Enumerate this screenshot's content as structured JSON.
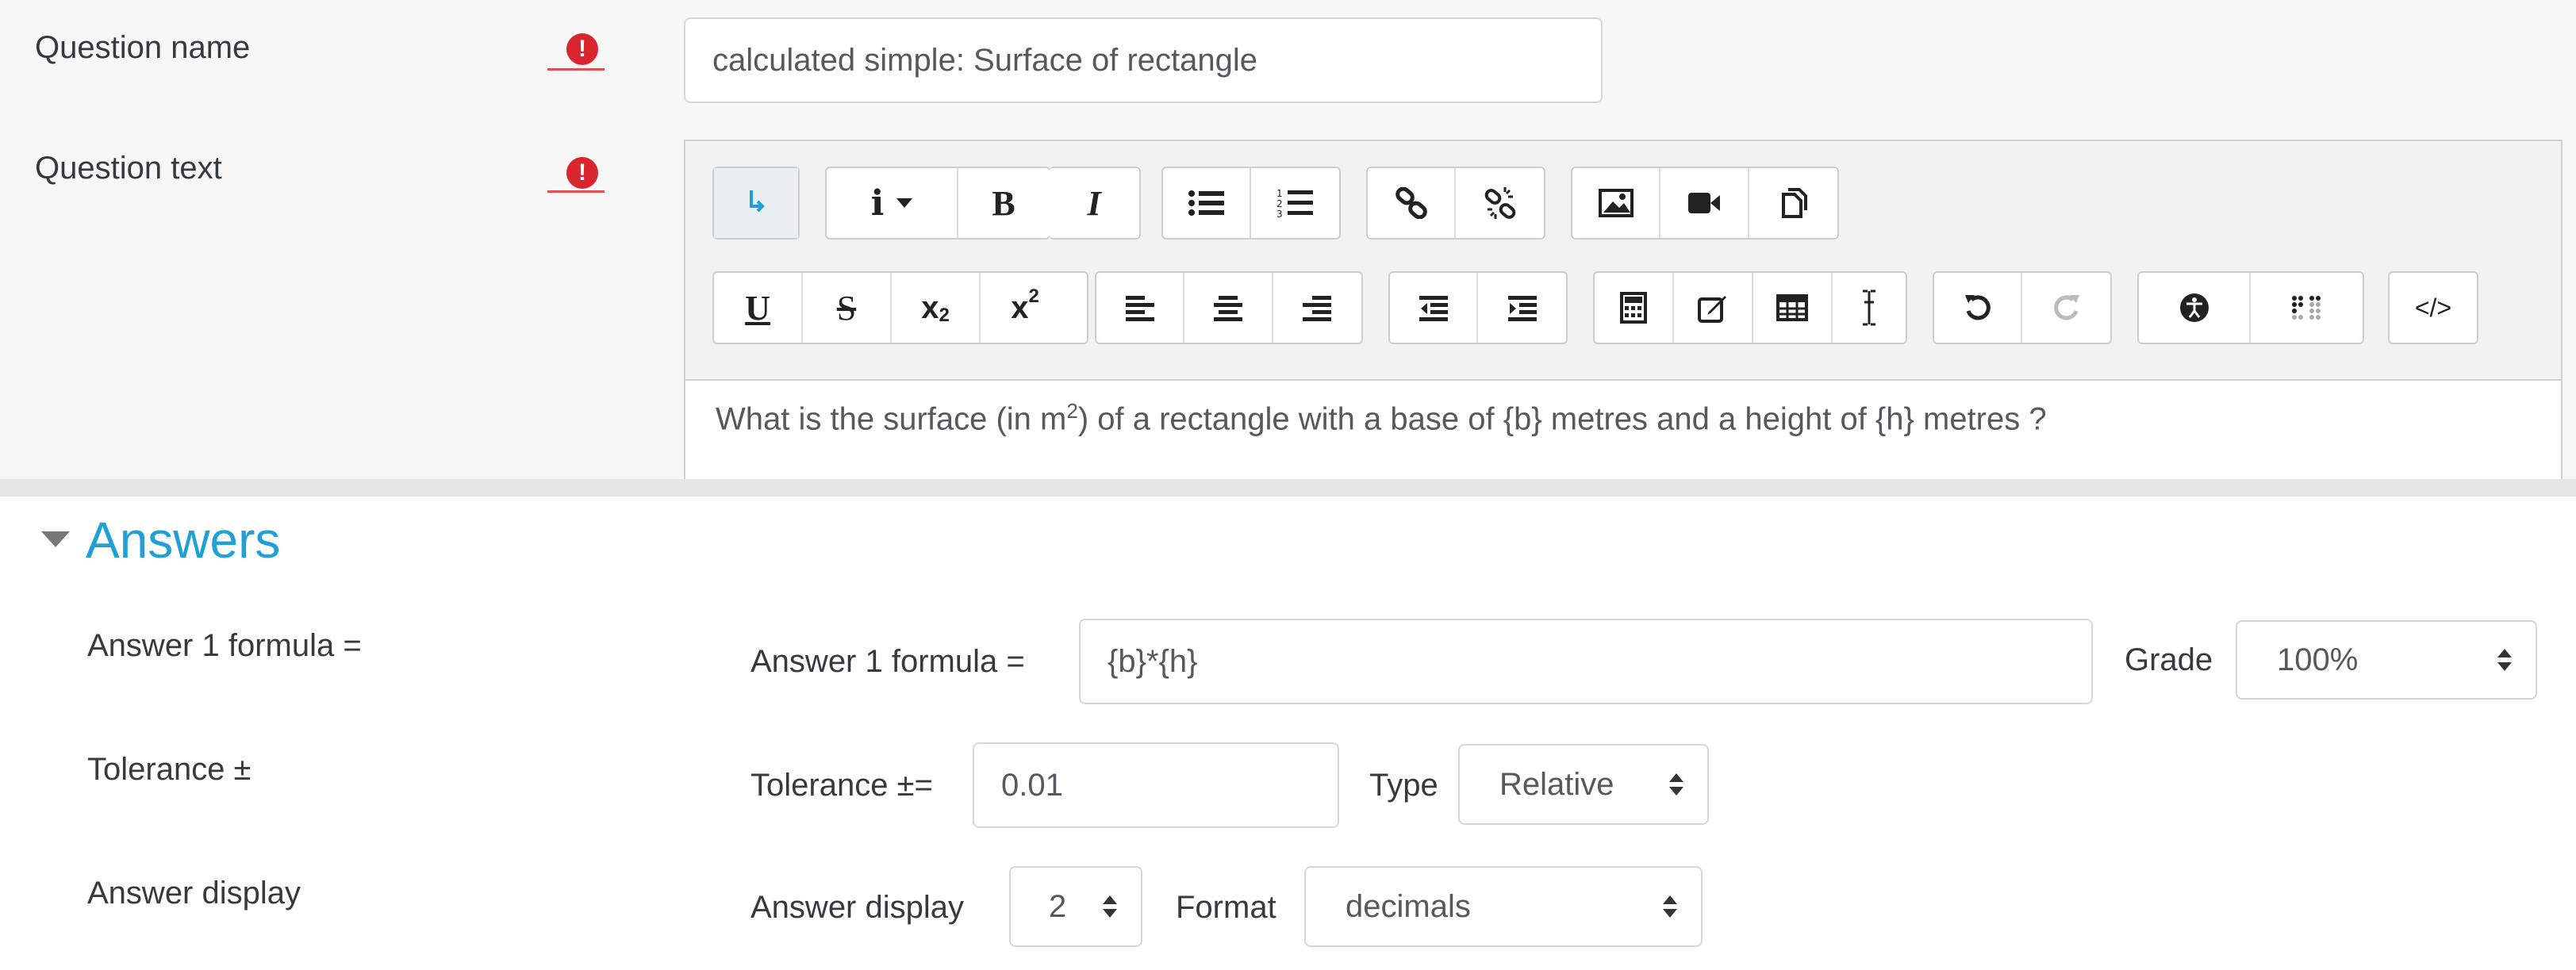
{
  "question_name": {
    "label": "Question name",
    "value": "calculated simple: Surface of rectangle"
  },
  "question_text": {
    "label": "Question text",
    "content_before": "What is the surface (in m",
    "content_sup": "2",
    "content_after": ") of a rectangle with a base of {b} metres and a height of {h} metres ?"
  },
  "toolbar": {
    "row1": [
      "toggle-toolbar-icon",
      "info-icon",
      "bold-icon",
      "italic-icon",
      "unordered-list-icon",
      "ordered-list-icon",
      "link-icon",
      "unlink-icon",
      "image-icon",
      "video-icon",
      "manage-files-icon"
    ],
    "row2": [
      "underline-icon",
      "strikethrough-icon",
      "subscript-icon",
      "superscript-icon",
      "align-left-icon",
      "align-center-icon",
      "align-right-icon",
      "outdent-icon",
      "indent-icon",
      "equation-icon",
      "edit-icon",
      "table-icon",
      "clear-format-icon",
      "undo-icon",
      "redo-icon",
      "accessibility-checker-icon",
      "screenreader-helper-icon",
      "html-icon"
    ],
    "glyphs": {
      "bold": "B",
      "italic": "I",
      "underline": "U",
      "strike": "S",
      "sub_x": "x",
      "sub_2": "2",
      "sup_x": "x",
      "sup_2": "2",
      "info": "i",
      "html": "</>"
    }
  },
  "answers": {
    "section_title": "Answers",
    "rows": [
      {
        "left_label": "Answer 1 formula =",
        "inner_label": "Answer 1 formula =",
        "value": "{b}*{h}",
        "select_label": "Grade",
        "select_value": "100%"
      },
      {
        "left_label": "Tolerance ±",
        "inner_label": "Tolerance ±=",
        "value": "0.01",
        "select_label": "Type",
        "select_value": "Relative"
      },
      {
        "left_label": "Answer display",
        "inner_label": "Answer display",
        "value": "2",
        "select_label": "Format",
        "select_value": "decimals"
      }
    ]
  },
  "colors": {
    "required": "#d9262e",
    "section_title": "#1fa0d6"
  }
}
